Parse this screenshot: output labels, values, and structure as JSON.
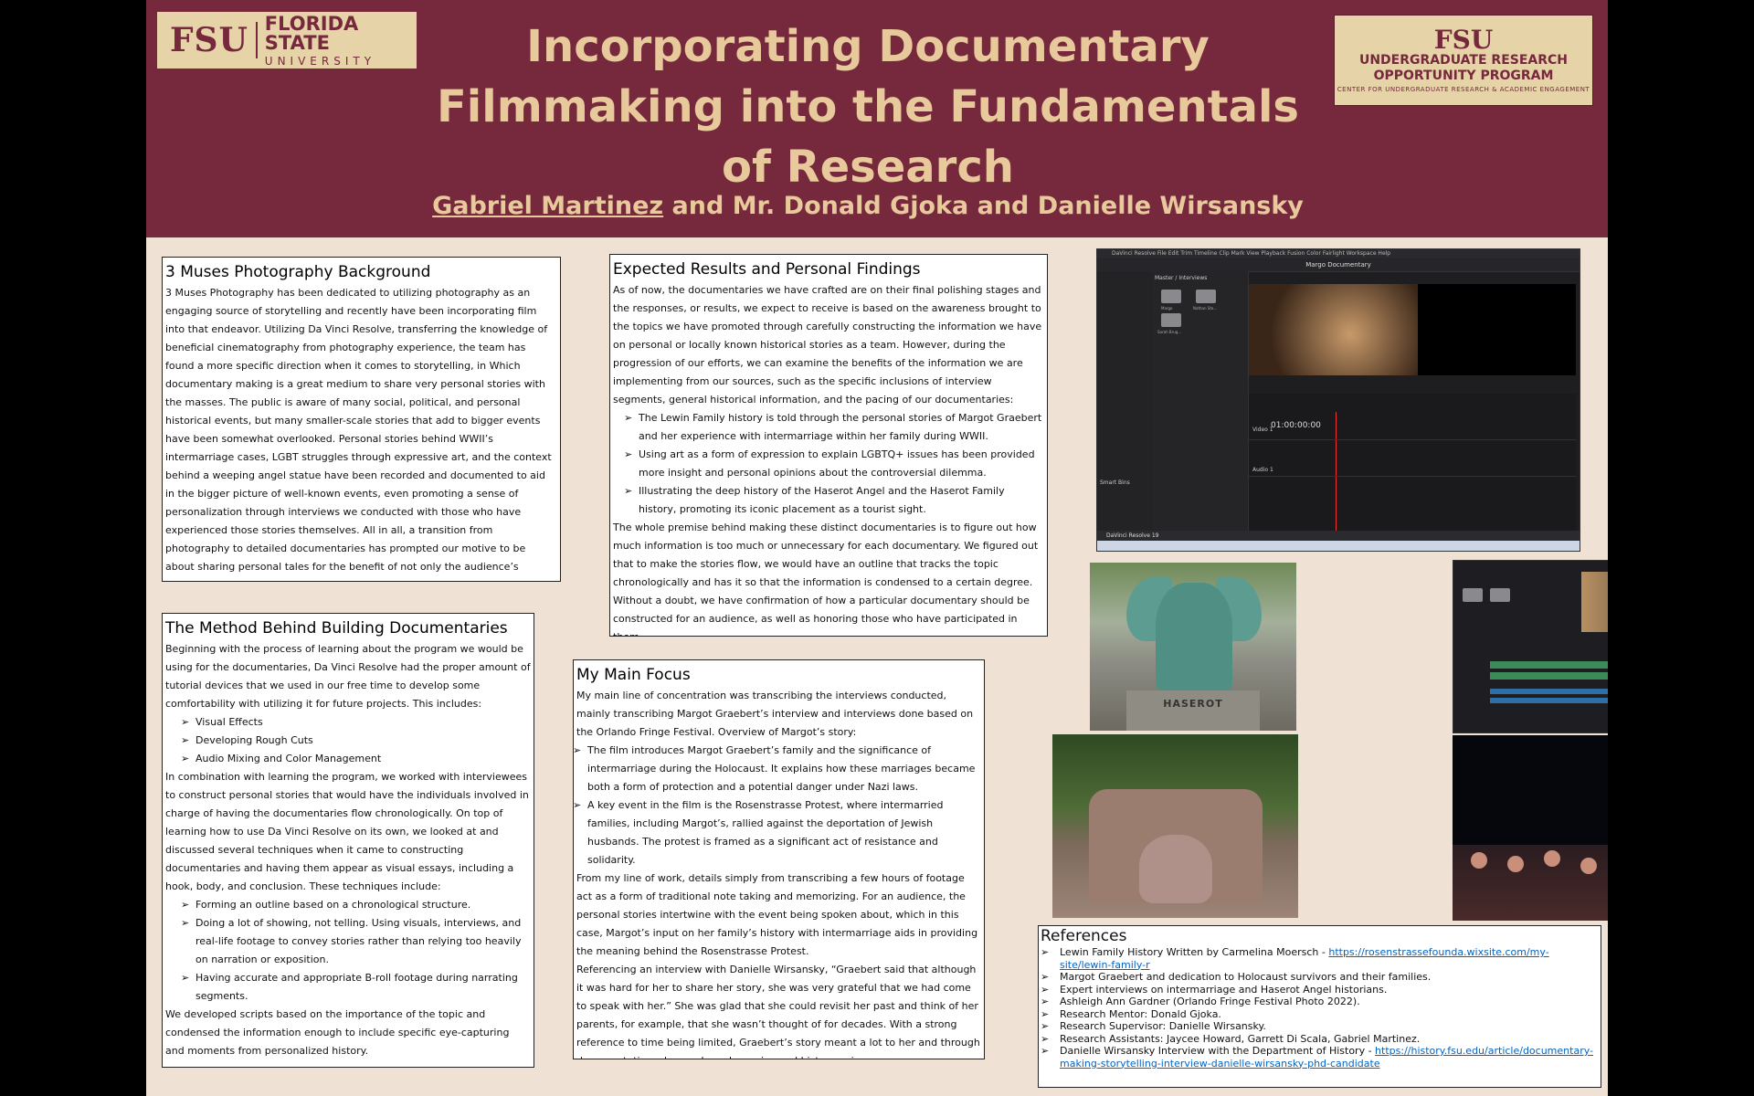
{
  "header": {
    "fsu_logo": {
      "mark": "FSU",
      "name_line1": "FLORIDA STATE",
      "name_line2": "UNIVERSITY"
    },
    "urop_logo": {
      "mark": "FSU",
      "line1": "UNDERGRADUATE RESEARCH",
      "line2": "OPPORTUNITY PROGRAM",
      "line3": "CENTER FOR UNDERGRADUATE RESEARCH & ACADEMIC ENGAGEMENT"
    },
    "title": "Incorporating Documentary Filmmaking into the Fundamentals of Research",
    "lead_author": "Gabriel Martinez",
    "other_authors": " and Mr. Donald Gjoka and Danielle Wirsansky"
  },
  "colors": {
    "maroon": "#76283d",
    "gold": "#e7c99b",
    "background": "#efe2d4"
  },
  "background_section": {
    "heading": "3 Muses Photography Background",
    "body": "3 Muses Photography has been dedicated to utilizing photography as an engaging source of storytelling and recently have been incorporating film into that endeavor. Utilizing Da Vinci Resolve, transferring the knowledge of beneficial cinematography from photography experience, the team has found a more specific direction when it comes to storytelling, in Which documentary making is a great medium to share very personal stories with the masses. The public is aware of many social, political, and personal historical events, but many smaller-scale stories that add to bigger events have been somewhat overlooked. Personal stories behind WWII’s intermarriage cases, LGBT struggles through expressive art, and the context behind a weeping angel statue have been recorded and documented to aid in the bigger picture of well-known events, even promoting a sense of personalization through interviews we conducted with those who have experienced those stories themselves. All in all, a transition from photography to detailed documentaries has prompted our motive to be about sharing personal tales for the benefit of not only the audience’s awareness, but the people involved who can finally share their rich history."
  },
  "method_section": {
    "heading": "The Method Behind Building Documentaries",
    "intro": "Beginning with the process of learning about the program we would be using for the documentaries, Da Vinci Resolve had the proper amount of tutorial devices that we used in our free time to develop some comfortability with utilizing it for future projects. This includes:",
    "list1": [
      "Visual Effects",
      "Developing Rough Cuts",
      "Audio Mixing and Color Management"
    ],
    "middle": "In combination with learning the program, we worked with interviewees to construct personal stories that would have the individuals involved in charge of having the documentaries flow chronologically. On top of learning how to use Da Vinci Resolve on its own, we looked at and discussed several techniques when it came to constructing documentaries and having them appear as visual essays, including a hook, body, and conclusion. These techniques include:",
    "list2": [
      "Forming an outline based on a chronological structure.",
      "Doing a lot of showing, not telling. Using visuals, interviews, and real-life footage to convey stories rather than relying too heavily on narration or exposition.",
      "Having accurate and appropriate B-roll footage during narrating segments."
    ],
    "outro": "We developed scripts based on the importance of the topic and condensed the information enough to include specific eye-capturing and moments from personalized history."
  },
  "results_section": {
    "heading": "Expected Results and Personal Findings",
    "intro": "As of now, the documentaries we have crafted are on their final polishing stages and the responses, or results, we expect to receive is based on the awareness brought to the topics we have promoted through carefully constructing the information we have on personal or locally known historical stories as a team. However, during the progression of our efforts, we can examine the benefits of the information we are implementing from our sources, such as the specific inclusions of interview segments, general historical information, and the pacing of our documentaries:",
    "list": [
      "The Lewin Family history is told through the personal stories of Margot Graebert and her experience with intermarriage within her family during WWII.",
      "Using art as a form of expression to explain LGBTQ+ issues has been provided more insight and personal opinions about the controversial dilemma.",
      "Illustrating the deep history of the Haserot Angel and the Haserot Family history, promoting its iconic placement as a tourist sight."
    ],
    "outro": "The whole premise behind making these distinct documentaries is to figure out how much information is too much or unnecessary for each documentary. We figured out that to make the stories flow, we would have an outline that tracks the topic chronologically and has it so that the information is condensed to a certain degree. Without a doubt, we have confirmation of how a particular documentary should be constructed for an audience, as well as honoring those who have participated in them."
  },
  "focus_section": {
    "heading": "My Main Focus",
    "intro": "My main line of concentration was transcribing the interviews conducted, mainly transcribing Margot Graebert’s interview and interviews done based on the Orlando Fringe Festival. Overview of Margot’s story:",
    "list": [
      "The film introduces Margot Graebert’s family and the significance of intermarriage during the Holocaust. It explains how these marriages became both a form of protection and a potential danger under Nazi laws.",
      "A key event in the film is the Rosenstrasse Protest, where intermarried families, including Margot’s, rallied against the deportation of Jewish husbands. The protest is framed as a significant act of resistance and solidarity."
    ],
    "para1": "From my line of work, details simply from transcribing a few hours of footage act as a form of traditional note taking and memorizing. For an audience, the personal stories intertwine with the event being spoken about, which in this case, Margot’s input on her family’s history with intermarriage aids in providing the meaning behind the Rosenstrasse Protest.",
    "para2": "Referencing an interview with Danielle Wirsansky, “Graebert said that although it was hard for her to share her story, she was very grateful that we had come to speak with her.” She was glad that she could revisit her past and think of her parents, for example, that she wasn’t thought of for decades. With a strong reference to time being limited, Graebert’s story meant a lot to her and through documentation, she can have her voice and history gain awareness."
  },
  "references": {
    "heading": "References",
    "items": [
      {
        "text": "Lewin Family History Written by Carmelina Moersch - ",
        "link": "https://rosenstrassefounda.wixsite.com/my-site/lewin-family-r"
      },
      {
        "text": "Margot Graebert and dedication to Holocaust survivors and their families.",
        "link": ""
      },
      {
        "text": "Expert interviews on intermarriage and Haserot Angel historians.",
        "link": ""
      },
      {
        "text": "Ashleigh Ann Gardner (Orlando Fringe Festival Photo 2022).",
        "link": ""
      },
      {
        "text": "Research Mentor: Donald Gjoka.",
        "link": ""
      },
      {
        "text": "Research Supervisor: Danielle Wirsansky.",
        "link": ""
      },
      {
        "text": "Research Assistants: Jaycee Howard, Garrett Di Scala, Gabriel Martinez.",
        "link": ""
      },
      {
        "text": "Danielle Wirsansky Interview with the Department of History - ",
        "link": "https://history.fsu.edu/article/documentary-making-storytelling-interview-danielle-wirsansky-phd-candidate"
      }
    ]
  },
  "screenshot_resolve": {
    "menubar": "DaVinci Resolve  File  Edit  Trim  Timeline  Clip  Mark  View  Playback  Fusion  Color  Fairlight  Workspace  Help",
    "project_title": "Margo Documentary",
    "timecode": "01:00:00:00",
    "bin_root": "Master / Interviews",
    "track_v1": "Video 1",
    "track_a1": "Audio 1",
    "smart_bins": "Smart Bins",
    "app_footer": "DaVinci Resolve 19",
    "folders": [
      "Margo",
      "Nathan Ste...",
      "Sarah Brug..."
    ]
  },
  "photo_labels": {
    "angel_inscription": "HASEROT"
  }
}
